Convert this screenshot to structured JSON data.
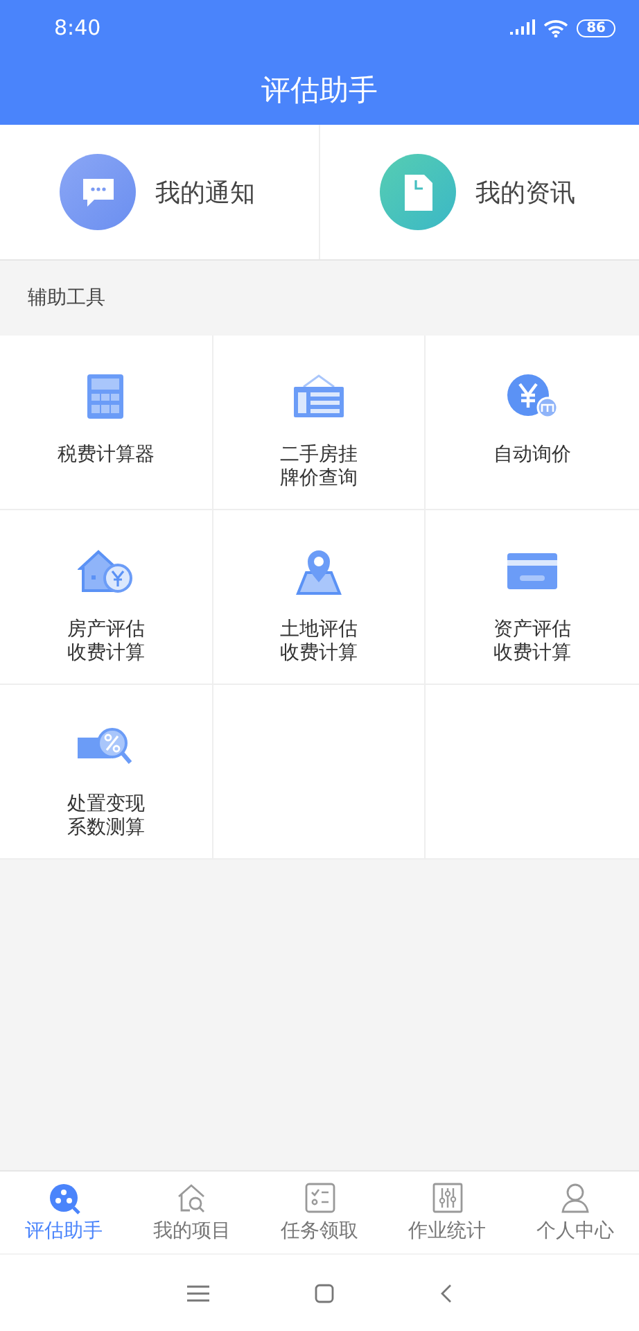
{
  "status_bar": {
    "time": "8:40",
    "battery": "86"
  },
  "title": "评估助手",
  "shortcuts": [
    {
      "kind": "chat",
      "label": "我的通知"
    },
    {
      "kind": "doc",
      "label": "我的资讯"
    }
  ],
  "section_title": "辅助工具",
  "tools": [
    {
      "kind": "calculator",
      "label": "税费计算器"
    },
    {
      "kind": "sign",
      "label": "二手房挂牌价查询"
    },
    {
      "kind": "yen",
      "label": "自动询价"
    },
    {
      "kind": "house",
      "label": "房产评估收费计算"
    },
    {
      "kind": "pin",
      "label": "土地评估收费计算"
    },
    {
      "kind": "card",
      "label": "资产评估收费计算"
    },
    {
      "kind": "percent",
      "label": "处置变现系数测算"
    }
  ],
  "tabs": [
    {
      "kind": "assist",
      "label": "评估助手",
      "selected": true
    },
    {
      "kind": "project",
      "label": "我的项目",
      "selected": false
    },
    {
      "kind": "task",
      "label": "任务领取",
      "selected": false
    },
    {
      "kind": "stats",
      "label": "作业统计",
      "selected": false
    },
    {
      "kind": "user",
      "label": "个人中心",
      "selected": false
    }
  ]
}
